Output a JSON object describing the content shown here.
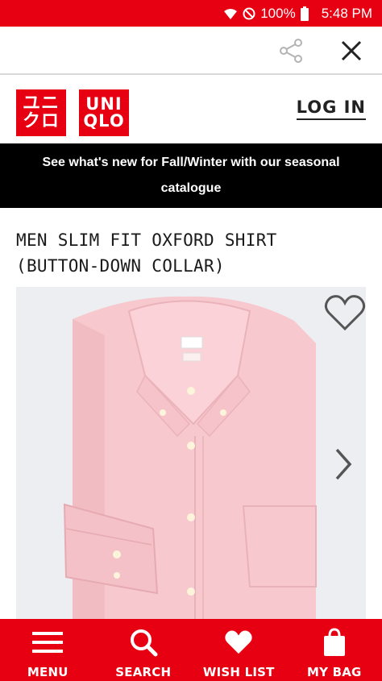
{
  "status_bar": {
    "battery": "100%",
    "time": "5:48 PM",
    "icons": [
      "wifi-icon",
      "do-not-disturb-icon",
      "battery-icon"
    ]
  },
  "action_bar": {
    "share_icon": "share-icon",
    "close_icon": "close-icon"
  },
  "brand": {
    "logo_katakana_top": "ユニ",
    "logo_katakana_bottom": "クロ",
    "logo_latin_top": "UNI",
    "logo_latin_bottom": "QLO",
    "login_label": "LOG IN",
    "brand_color": "#e60012"
  },
  "promo": {
    "text": "See what's new for Fall/Winter with our seasonal catalogue"
  },
  "product": {
    "title_line1": "MEN SLIM FIT OXFORD SHIRT",
    "title_line2": "(BUTTON-DOWN COLLAR)",
    "shirt_color": "#f8c9cf",
    "wishlist_icon": "heart-outline-icon",
    "next_icon": "chevron-right-icon"
  },
  "bottom_nav": {
    "items": [
      {
        "label": "MENU",
        "icon": "menu-icon"
      },
      {
        "label": "SEARCH",
        "icon": "search-icon"
      },
      {
        "label": "WISH LIST",
        "icon": "heart-icon"
      },
      {
        "label": "MY BAG",
        "icon": "bag-icon"
      }
    ]
  }
}
